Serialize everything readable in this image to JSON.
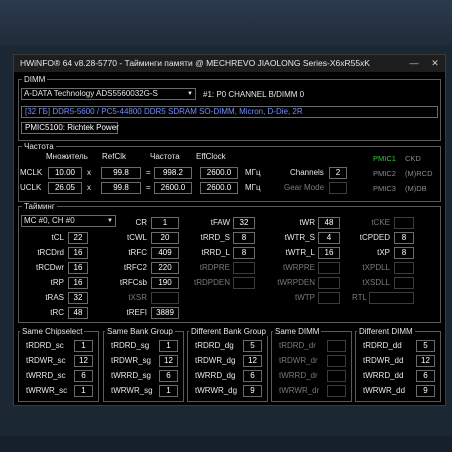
{
  "window": {
    "title": "HWiNFO® 64 v8.28-5770 - Тайминги памяти @ MECHREVO JIAOLONG Series-X6xR55xK",
    "minimize_icon": "minimize-icon",
    "close_icon": "close-icon"
  },
  "dimm": {
    "group_label": "DIMM",
    "module_selected": "A-DATA Technology ADS5560032G-S",
    "slot": "#1: P0 CHANNEL B/DIMM 0",
    "description": "[32 ГБ] DDR5-5600 / PC5-44800 DDR5 SDRAM SO-DIMM, Micron, D-Die, 2R",
    "pmic": "PMIC5100: Richtek Power"
  },
  "freq": {
    "group_label": "Частота",
    "col_mult": "Множитель",
    "col_refclk": "RefClk",
    "col_freq": "Частота",
    "col_effclock": "EffClock",
    "mclk_label": "MCLK",
    "mclk_mult": "10.00",
    "mclk_refclk": "99.8",
    "mclk_freq": "998.2",
    "mclk_eff": "2600.0",
    "uclk_label": "UCLK",
    "uclk_mult": "26.05",
    "uclk_refclk": "99.8",
    "uclk_freq": "2600.0",
    "uclk_eff": "2600.0",
    "x": "x",
    "eq": "=",
    "unit": "МГц",
    "channels_label": "Channels",
    "channels_value": "2",
    "gearmode_label": "Gear Mode",
    "gearmode_value": "",
    "pmic1": "PMIC1",
    "pmic2": "PMIC2",
    "pmic3": "PMIC3",
    "ckd": "CKD",
    "mrcd": "(M)RCD",
    "mdb": "(M)DB",
    "pmic1_color": "#3ec43e"
  },
  "timings": {
    "group_label": "Тайминг",
    "mc_selected": "MC #0, CH #0",
    "tCL": "22",
    "tRCDrd": "16",
    "tRCDwr": "16",
    "tRP": "16",
    "tRAS": "32",
    "tRC": "48",
    "CR": "1",
    "tCWL": "20",
    "tRFC": "409",
    "tRFC2": "220",
    "tRFCsb": "190",
    "tXSR": "",
    "tREFI": "3889",
    "tFAW": "32",
    "tRRD_S": "8",
    "tRRD_L": "8",
    "tRDPRE": "",
    "tRDPDEN": "",
    "tWR": "48",
    "tWTR_S": "4",
    "tWTR_L": "16",
    "tWRPRE": "",
    "tWRPDEN": "",
    "tWTP": "",
    "tCKE": "",
    "tCPDED": "8",
    "tXP": "8",
    "tXPDLL": "",
    "tXSDLL": "",
    "RTL": ""
  },
  "bottom": {
    "same_chipselect": {
      "label": "Same Chipselect",
      "tRDRD": "1",
      "tRDWR": "12",
      "tWRRD": "6",
      "tWRWR": "1"
    },
    "same_bank_group": {
      "label": "Same Bank Group",
      "tRDRD": "1",
      "tRDWR": "12",
      "tWRRD": "6",
      "tWRWR": "1"
    },
    "diff_bank_group": {
      "label": "Different Bank Group",
      "tRDRD": "5",
      "tRDWR": "12",
      "tWRRD": "6",
      "tWRWR": "9"
    },
    "same_dimm": {
      "label": "Same DIMM",
      "tRDRD": "",
      "tRDWR": "",
      "tWRRD": "",
      "tWRWR": ""
    },
    "diff_dimm": {
      "label": "Different DIMM",
      "tRDRD": "5",
      "tRDWR": "12",
      "tWRRD": "6",
      "tWRWR": "9"
    }
  }
}
